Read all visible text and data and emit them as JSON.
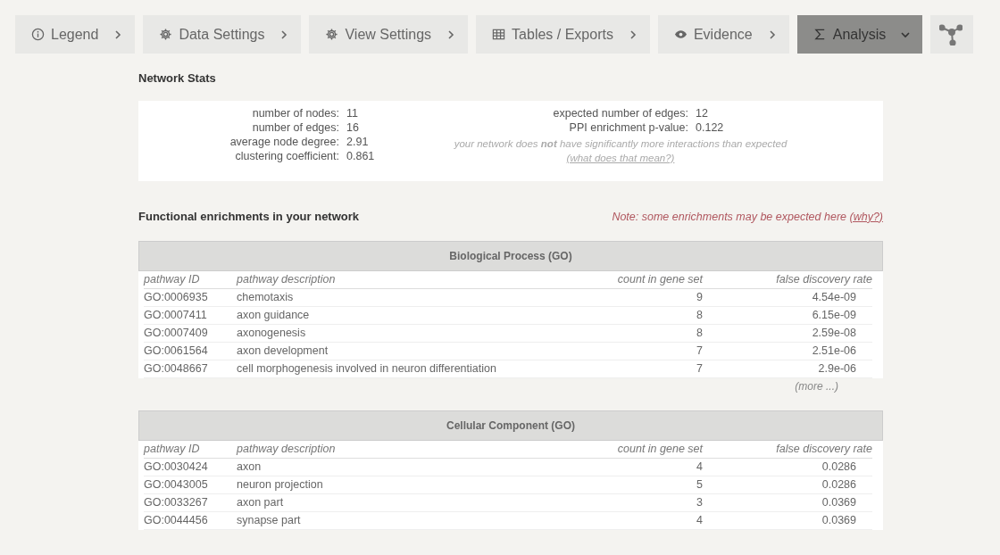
{
  "tabs": [
    {
      "kind": "info",
      "label": "Legend",
      "expanded": false,
      "selected": false
    },
    {
      "kind": "gear",
      "label": "Data Settings",
      "expanded": false,
      "selected": false
    },
    {
      "kind": "gear",
      "label": "View Settings",
      "expanded": false,
      "selected": false
    },
    {
      "kind": "table",
      "label": "Tables / Exports",
      "expanded": false,
      "selected": false
    },
    {
      "kind": "eye",
      "label": "Evidence",
      "expanded": false,
      "selected": false
    },
    {
      "kind": "sigma",
      "label": "Analysis",
      "expanded": true,
      "selected": true
    },
    {
      "kind": "network",
      "selected": false
    }
  ],
  "network_stats": {
    "title": "Network Stats",
    "left": [
      {
        "label": "number of nodes:",
        "value": "11"
      },
      {
        "label": "number of edges:",
        "value": "16"
      },
      {
        "label": "average node degree:",
        "value": "2.91"
      },
      {
        "label": "clustering coefficient:",
        "value": "0.861"
      }
    ],
    "right": [
      {
        "label": "expected number of edges:",
        "value": "12"
      },
      {
        "label": "PPI enrichment p-value:",
        "value": "0.122"
      }
    ],
    "note": "your network does **not** have significantly more interactions than expected",
    "note_link": "(what does that mean?)"
  },
  "enrichment": {
    "title": "Functional enrichments in your network",
    "note": "Note: some enrichments may be expected here",
    "note_link": "(why?)",
    "tables": [
      {
        "title": "Biological Process (GO)",
        "columns": [
          "pathway ID",
          "pathway description",
          "count in gene set",
          "false discovery rate"
        ],
        "rows": [
          [
            "GO:0006935",
            "chemotaxis",
            "9",
            "4.54e-09"
          ],
          [
            "GO:0007411",
            "axon guidance",
            "8",
            "6.15e-09"
          ],
          [
            "GO:0007409",
            "axonogenesis",
            "8",
            "2.59e-08"
          ],
          [
            "GO:0061564",
            "axon development",
            "7",
            "2.51e-06"
          ],
          [
            "GO:0048667",
            "cell morphogenesis involved in neuron differentiation",
            "7",
            "2.9e-06"
          ]
        ],
        "more": "(more ...)"
      },
      {
        "title": "Cellular Component (GO)",
        "columns": [
          "pathway ID",
          "pathway description",
          "count in gene set",
          "false discovery rate"
        ],
        "rows": [
          [
            "GO:0030424",
            "axon",
            "4",
            "0.0286"
          ],
          [
            "GO:0043005",
            "neuron projection",
            "5",
            "0.0286"
          ],
          [
            "GO:0033267",
            "axon part",
            "3",
            "0.0369"
          ],
          [
            "GO:0044456",
            "synapse part",
            "4",
            "0.0369"
          ]
        ]
      }
    ]
  }
}
